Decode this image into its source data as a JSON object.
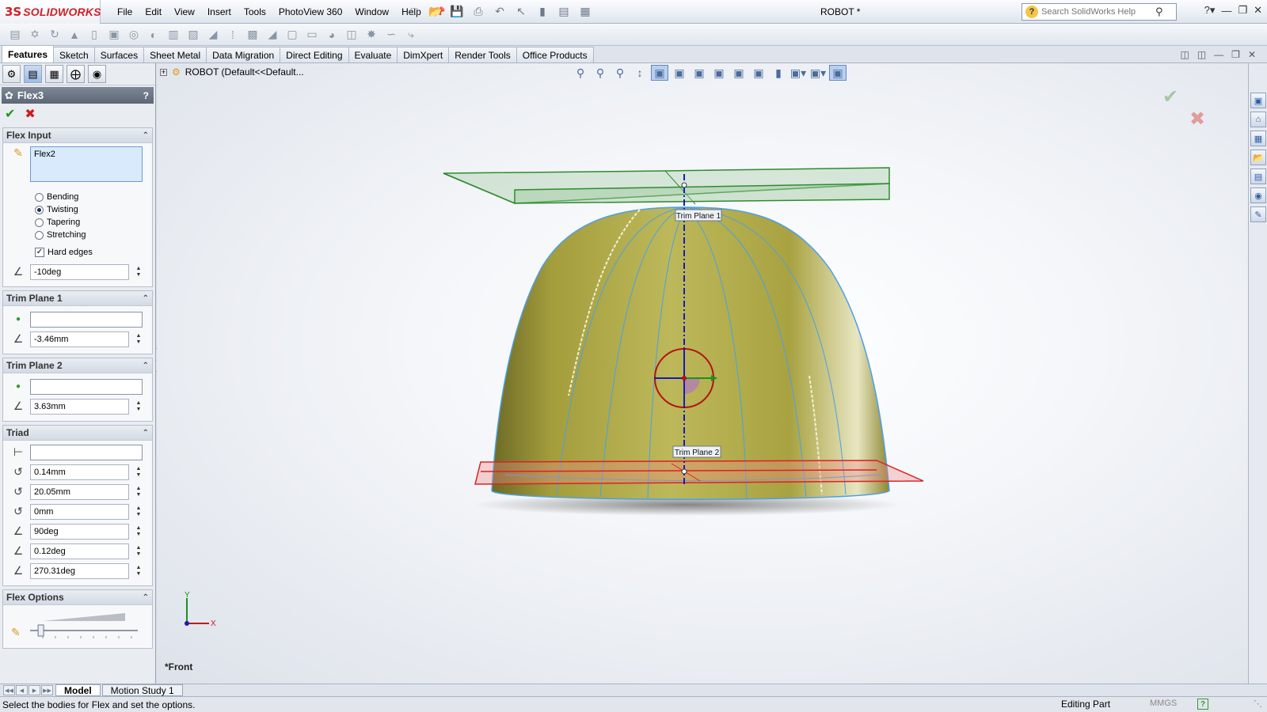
{
  "app": {
    "brand": "SOLIDWORKS",
    "document_title": "ROBOT *",
    "menus": [
      "File",
      "Edit",
      "View",
      "Insert",
      "Tools",
      "PhotoView 360",
      "Window",
      "Help"
    ],
    "search_placeholder": "Search SolidWorks Help"
  },
  "command_tabs": [
    {
      "label": "Features",
      "active": true
    },
    {
      "label": "Sketch",
      "active": false
    },
    {
      "label": "Surfaces",
      "active": false
    },
    {
      "label": "Sheet Metal",
      "active": false
    },
    {
      "label": "Data Migration",
      "active": false
    },
    {
      "label": "Direct Editing",
      "active": false
    },
    {
      "label": "Evaluate",
      "active": false
    },
    {
      "label": "DimXpert",
      "active": false
    },
    {
      "label": "Render Tools",
      "active": false
    },
    {
      "label": "Office Products",
      "active": false
    }
  ],
  "property_manager": {
    "title": "Flex3",
    "help": "?",
    "flex_input": {
      "heading": "Flex Input",
      "bodies": "Flex2",
      "options": [
        {
          "label": "Bending",
          "selected": false
        },
        {
          "label": "Twisting",
          "selected": true
        },
        {
          "label": "Tapering",
          "selected": false
        },
        {
          "label": "Stretching",
          "selected": false
        }
      ],
      "hard_edges_label": "Hard edges",
      "hard_edges_checked": true,
      "angle": "-10deg"
    },
    "trim_plane_1": {
      "heading": "Trim Plane 1",
      "value": "-3.46mm"
    },
    "trim_plane_2": {
      "heading": "Trim Plane 2",
      "value": "3.63mm"
    },
    "triad": {
      "heading": "Triad",
      "x": "0.14mm",
      "y": "20.05mm",
      "z": "0mm",
      "rot_x": "90deg",
      "rot_y": "0.12deg",
      "rot_z": "270.31deg"
    },
    "flex_options": {
      "heading": "Flex Options",
      "accuracy": 0.1
    }
  },
  "graphics": {
    "tree_root": "ROBOT  (Default<<Default...",
    "callout_1": "Trim Plane 1",
    "callout_2": "Trim Plane 2",
    "view_name": "*Front",
    "axis_x": "X",
    "axis_y": "Y"
  },
  "bottom_tabs": [
    {
      "label": "Model",
      "active": true
    },
    {
      "label": "Motion Study 1",
      "active": false
    }
  ],
  "status": {
    "message": "Select the bodies for Flex and set the options.",
    "mode": "Editing Part",
    "units": "MMGS",
    "help": "?"
  },
  "colors": {
    "dome": "#a6a03e",
    "trim_plane_1": "#2e8b2e",
    "trim_plane_2": "#e02020",
    "axis_line": "#1a1ab4",
    "edge": "#4aa0e6",
    "brand": "#d0202a"
  }
}
